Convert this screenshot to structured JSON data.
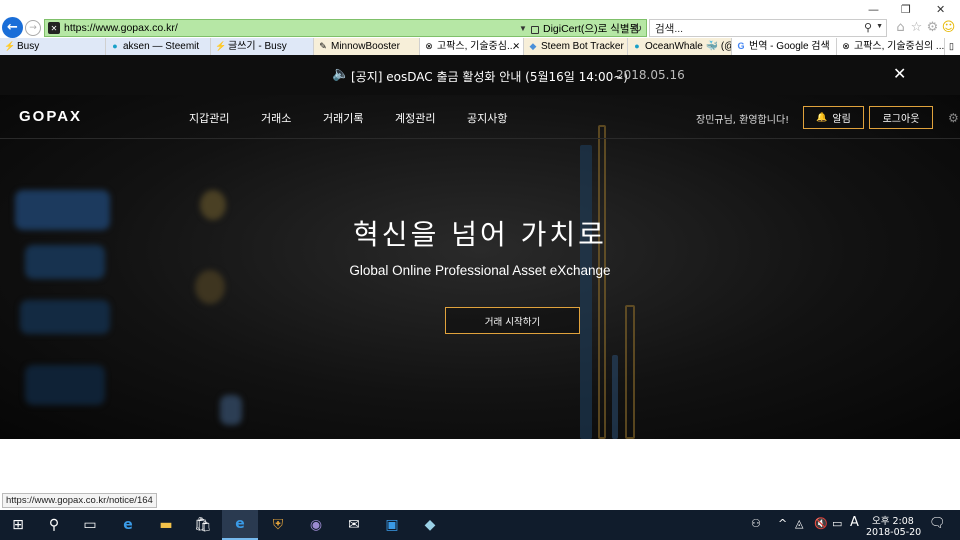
{
  "browser": {
    "url": "https://www.gopax.co.kr/",
    "cert_label": "DigiCert(으)로 식별됨",
    "search_placeholder": "검색...",
    "tabs": [
      {
        "label": "Busy",
        "icon": "busy-icon"
      },
      {
        "label": "aksen — Steemit",
        "icon": "steemit-icon"
      },
      {
        "label": "글쓰기 - Busy",
        "icon": "busy-icon"
      },
      {
        "label": "MinnowBooster",
        "icon": "minnow-icon"
      },
      {
        "label": "고팍스, 기술중심...",
        "icon": "gopax-icon"
      },
      {
        "label": "Steem Bot Tracker",
        "icon": "steem-icon"
      },
      {
        "label": "OceanWhale 🐳 (@...",
        "icon": "oceanwhale-icon"
      },
      {
        "label": "번역 - Google 검색",
        "icon": "google-icon"
      },
      {
        "label": "고팍스, 기술중심의 ...",
        "icon": "gopax-icon"
      }
    ],
    "status_url": "https://www.gopax.co.kr/notice/164"
  },
  "notice": {
    "text": "[공지] eosDAC 출금 활성화 안내 (5월16일 14:00~)",
    "date": "2018.05.16"
  },
  "header": {
    "logo": "GOPAX",
    "nav": [
      "지갑관리",
      "거래소",
      "거래기록",
      "계정관리",
      "공지사항"
    ],
    "welcome": "장민규님, 환영합니다!",
    "alert_label": "알림",
    "logout_label": "로그아웃"
  },
  "hero": {
    "title": "혁신을 넘어 가치로",
    "subtitle": "Global Online Professional Asset eXchange",
    "cta_label": "거래 시작하기"
  },
  "taskbar": {
    "time": "오후 2:08",
    "date": "2018-05-20",
    "ime": "A"
  },
  "colors": {
    "accent": "#e0a23c",
    "address_bar": "#b6e7a5",
    "taskbar": "#101c2c"
  }
}
